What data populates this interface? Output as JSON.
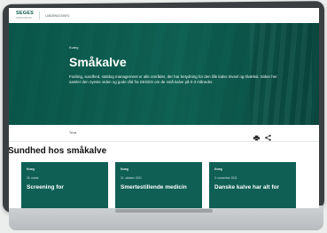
{
  "topbar": {
    "logo": "SEGES",
    "logo_sub": "INNOVATION",
    "nav_item": "LANDBRUGSINFO"
  },
  "hero": {
    "eyebrow": "Kvæg",
    "title": "Småkalve",
    "description": "Fodring, sundhed, staldog management er alle områder, der har betydning for den lille kalvs trivsel og tilvækst. Siden her samler den nyeste viden og gode råd fra SEGES om de små kalve på 0-3 måneder."
  },
  "toolstrip": {
    "tag": "Tema",
    "icons": [
      "print-icon",
      "share-icon"
    ]
  },
  "section": {
    "title": "Sundhed hos småkalve"
  },
  "cards": [
    {
      "tag": "Kvæg",
      "date": "26. marts",
      "title": "Screening for"
    },
    {
      "tag": "Kvæg",
      "date": "21. oktober 2021",
      "title": "Smertestillende medicin"
    },
    {
      "tag": "Kvæg",
      "date": "3. november 2021",
      "title": "Danske kalve har alt for"
    }
  ],
  "colors": {
    "brand_green": "#0b5b4a",
    "card_teal": "#0f5f55"
  }
}
